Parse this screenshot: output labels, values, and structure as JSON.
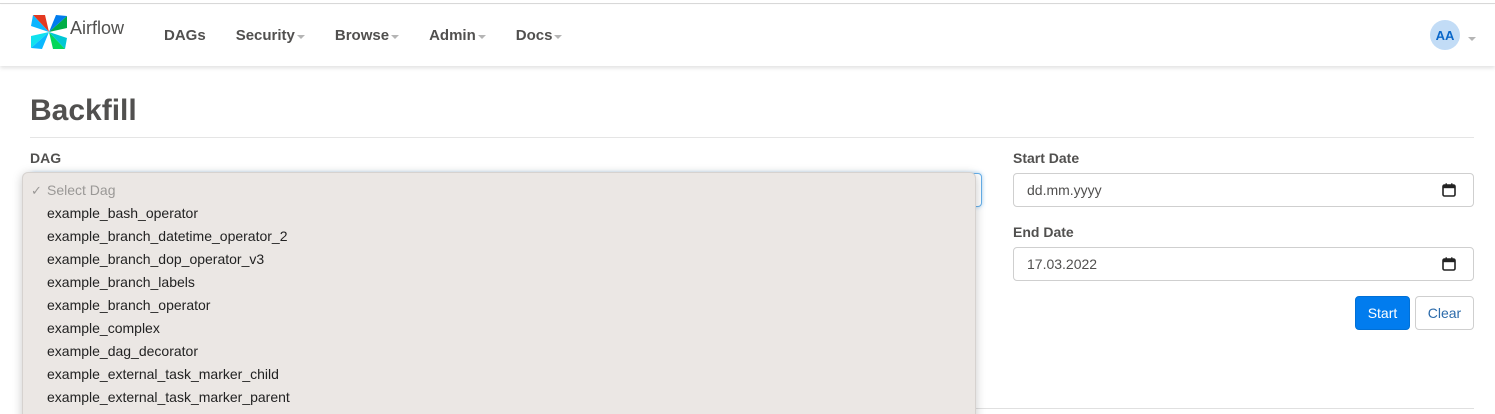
{
  "app": {
    "brand": "Airflow"
  },
  "nav": {
    "items": [
      {
        "label": "DAGs",
        "has_caret": false
      },
      {
        "label": "Security",
        "has_caret": true
      },
      {
        "label": "Browse",
        "has_caret": true
      },
      {
        "label": "Admin",
        "has_caret": true
      },
      {
        "label": "Docs",
        "has_caret": true
      }
    ],
    "avatar_initials": "AA"
  },
  "page": {
    "title": "Backfill"
  },
  "form": {
    "dag_label": "DAG",
    "start_label": "Start Date",
    "end_label": "End Date",
    "start_value": "dd.mm.yyyy",
    "end_value": "17.03.2022",
    "start_button": "Start",
    "clear_button": "Clear"
  },
  "dropdown": {
    "selected_index": 0,
    "options": [
      "Select Dag",
      "example_bash_operator",
      "example_branch_datetime_operator_2",
      "example_branch_dop_operator_v3",
      "example_branch_labels",
      "example_branch_operator",
      "example_complex",
      "example_dag_decorator",
      "example_external_task_marker_child",
      "example_external_task_marker_parent"
    ]
  },
  "colors": {
    "primary": "#017cee",
    "text": "#51504f",
    "avatar_bg": "#c2dcf6",
    "dropdown_bg": "#ebe7e4"
  }
}
